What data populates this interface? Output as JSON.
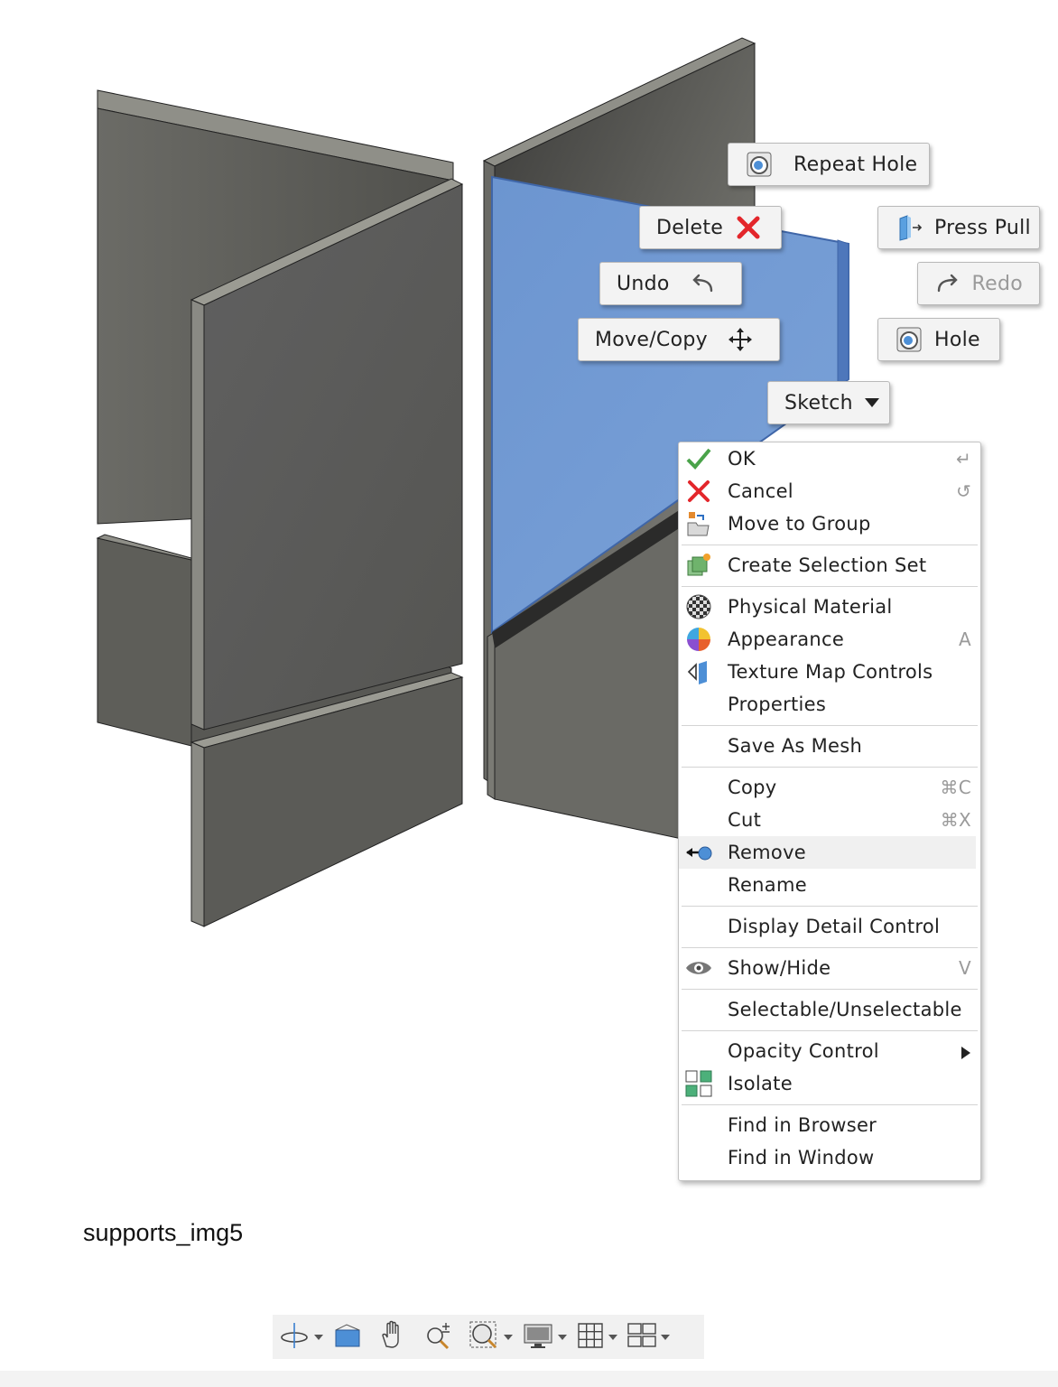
{
  "marking_menu": {
    "repeat_hole": "Repeat Hole",
    "delete": "Delete",
    "press_pull": "Press Pull",
    "undo": "Undo",
    "redo": "Redo",
    "move_copy": "Move/Copy",
    "hole": "Hole",
    "sketch": "Sketch"
  },
  "context_menu": {
    "items": [
      {
        "label": "OK",
        "shortcut": "↵",
        "icon": "check-icon"
      },
      {
        "label": "Cancel",
        "shortcut": "↺",
        "icon": "cancel-x-icon"
      },
      {
        "label": "Move to Group",
        "shortcut": "",
        "icon": "move-to-group-icon"
      },
      {
        "label": "Create Selection Set",
        "shortcut": "",
        "icon": "selection-set-icon"
      },
      {
        "label": "Physical Material",
        "shortcut": "",
        "icon": "physical-material-icon"
      },
      {
        "label": "Appearance",
        "shortcut": "A",
        "icon": "appearance-icon"
      },
      {
        "label": "Texture Map Controls",
        "shortcut": "",
        "icon": "texture-map-icon"
      },
      {
        "label": "Properties",
        "shortcut": ""
      },
      {
        "label": "Save As Mesh",
        "shortcut": ""
      },
      {
        "label": "Copy",
        "shortcut": "⌘C"
      },
      {
        "label": "Cut",
        "shortcut": "⌘X"
      },
      {
        "label": "Remove",
        "shortcut": "",
        "icon": "remove-icon"
      },
      {
        "label": "Rename",
        "shortcut": ""
      },
      {
        "label": "Display Detail Control",
        "shortcut": ""
      },
      {
        "label": "Show/Hide",
        "shortcut": "V",
        "icon": "eye-icon"
      },
      {
        "label": "Selectable/Unselectable",
        "shortcut": ""
      },
      {
        "label": "Opacity Control",
        "shortcut": "",
        "icon": "submenu-arrow-icon"
      },
      {
        "label": "Isolate",
        "shortcut": "",
        "icon": "isolate-icon"
      },
      {
        "label": "Find in Browser",
        "shortcut": ""
      },
      {
        "label": "Find in Window",
        "shortcut": ""
      }
    ]
  },
  "caption": "supports_img5",
  "colors": {
    "selection_blue": "#6f98d2",
    "body_gray": "#5d5d58",
    "delete_red": "#e3262b",
    "ok_green": "#4aa34a"
  },
  "toolbar_icons": [
    "orbit-icon",
    "look-at-icon",
    "pan-icon",
    "zoom-icon",
    "fit-icon",
    "display-settings-icon",
    "grid-icon",
    "viewports-icon"
  ]
}
